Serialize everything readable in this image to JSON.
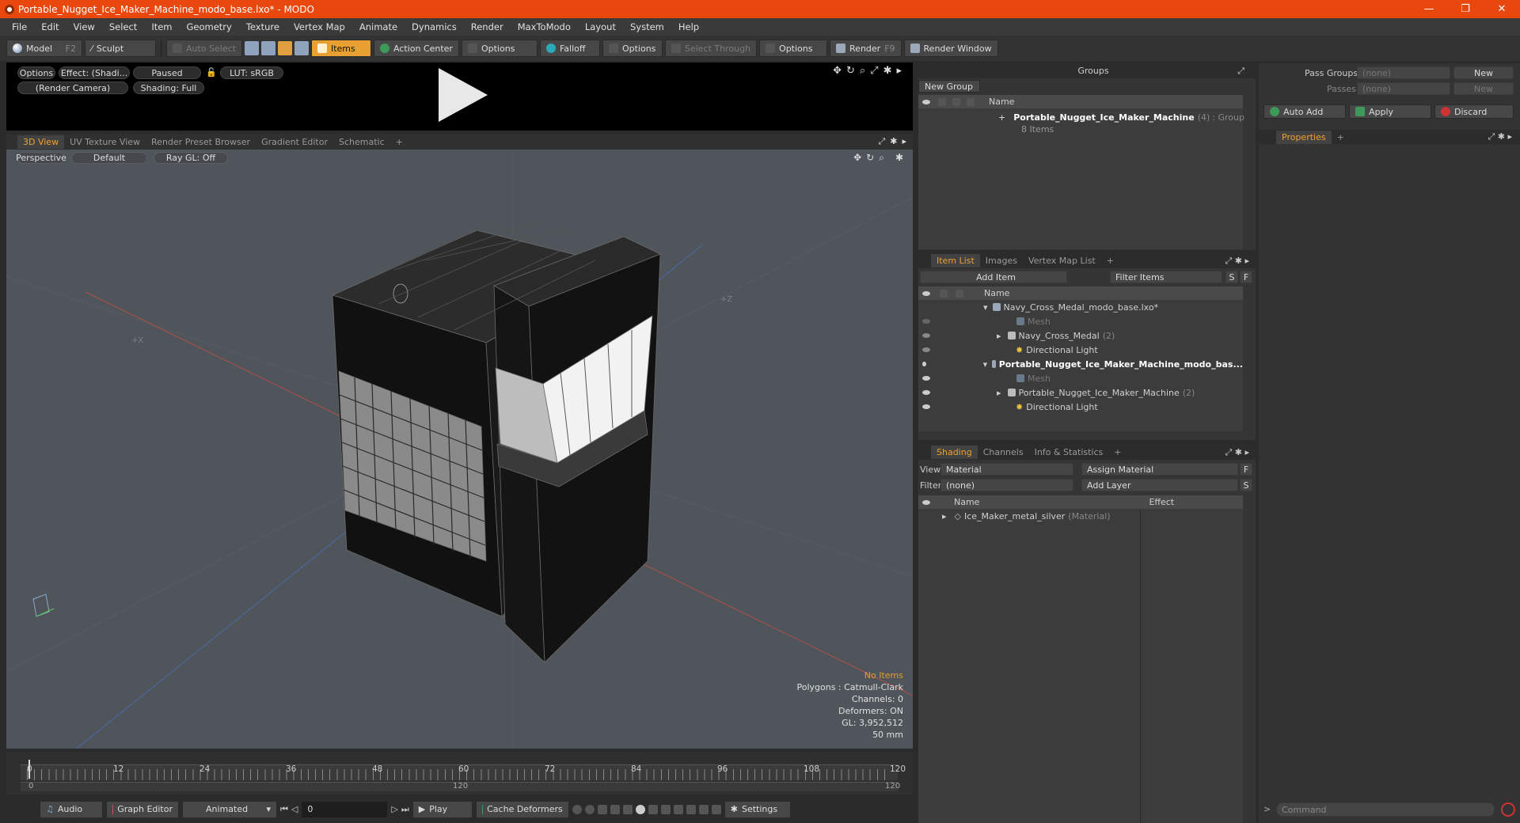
{
  "window": {
    "title": "Portable_Nugget_Ice_Maker_Machine_modo_base.lxo* - MODO"
  },
  "menu": [
    "File",
    "Edit",
    "View",
    "Select",
    "Item",
    "Geometry",
    "Texture",
    "Vertex Map",
    "Animate",
    "Dynamics",
    "Render",
    "MaxToModo",
    "Layout",
    "System",
    "Help"
  ],
  "toolbar": {
    "model": "Model",
    "model_key": "F2",
    "sculpt": "Sculpt",
    "auto_select": "Auto Select",
    "items": "Items",
    "action_center": "Action Center",
    "options1": "Options",
    "falloff": "Falloff",
    "options2": "Options",
    "select_through": "Select Through",
    "options3": "Options",
    "render": "Render",
    "render_key": "F9",
    "render_window": "Render Window"
  },
  "preview": {
    "options": "Options",
    "effect": "Effect: (Shadi...",
    "paused": "Paused",
    "lut": "LUT: sRGB",
    "camera": "(Render Camera)",
    "shading": "Shading: Full"
  },
  "viewtabs": [
    "3D View",
    "UV Texture View",
    "Render Preset Browser",
    "Gradient Editor",
    "Schematic"
  ],
  "viewport": {
    "perspective": "Perspective",
    "default": "Default",
    "raygl": "Ray GL: Off",
    "axis_x": "+X",
    "axis_z": "+Z",
    "info": {
      "no_items": "No Items",
      "polygons": "Polygons : Catmull-Clark",
      "channels": "Channels: 0",
      "deformers": "Deformers: ON",
      "gl": "GL: 3,952,512",
      "scale": "50 mm"
    }
  },
  "timeline": {
    "ticks": [
      "0",
      "12",
      "24",
      "36",
      "48",
      "60",
      "72",
      "84",
      "96",
      "108",
      "120"
    ],
    "sub_start": "0",
    "sub_mid": "120",
    "sub_end": "120"
  },
  "bottombar": {
    "audio": "Audio",
    "graph_editor": "Graph Editor",
    "animated": "Animated",
    "frame": "0",
    "play": "Play",
    "cache": "Cache Deformers",
    "settings": "Settings"
  },
  "groups": {
    "title": "Groups",
    "new_group": "New Group",
    "col_name": "Name",
    "item_name": "Portable_Nugget_Ice_Maker_Machine",
    "item_count": "(4)",
    "item_type": ": Group",
    "item_sub": "8 Items"
  },
  "passes": {
    "pass_groups": "Pass Groups",
    "passes": "Passes",
    "none1": "(none)",
    "none2": "(none)",
    "new1": "New",
    "new2": "New",
    "auto_add": "Auto Add",
    "apply": "Apply",
    "discard": "Discard",
    "properties": "Properties"
  },
  "itemlist": {
    "tabs": [
      "Item List",
      "Images",
      "Vertex Map List"
    ],
    "add_item": "Add Item",
    "filter": "Filter Items",
    "s": "S",
    "f": "F",
    "col_name": "Name",
    "rows": [
      {
        "label": "Navy_Cross_Medal_modo_base.lxo*",
        "extra": ""
      },
      {
        "label": "Mesh",
        "extra": ""
      },
      {
        "label": "Navy_Cross_Medal",
        "extra": "(2)"
      },
      {
        "label": "Directional Light",
        "extra": ""
      },
      {
        "label": "Portable_Nugget_Ice_Maker_Machine_modo_bas...",
        "extra": ""
      },
      {
        "label": "Mesh",
        "extra": ""
      },
      {
        "label": "Portable_Nugget_Ice_Maker_Machine",
        "extra": "(2)"
      },
      {
        "label": "Directional Light",
        "extra": ""
      }
    ]
  },
  "shading": {
    "tabs": [
      "Shading",
      "Channels",
      "Info & Statistics"
    ],
    "view_label": "View",
    "view_value": "Material",
    "assign": "Assign Material",
    "f": "F",
    "filter_label": "Filter",
    "filter_value": "(none)",
    "add_layer": "Add Layer",
    "s": "S",
    "col_name": "Name",
    "col_effect": "Effect",
    "row_name": "Ice_Maker_metal_silver",
    "row_type": "(Material)"
  },
  "command": {
    "placeholder": "Command"
  }
}
